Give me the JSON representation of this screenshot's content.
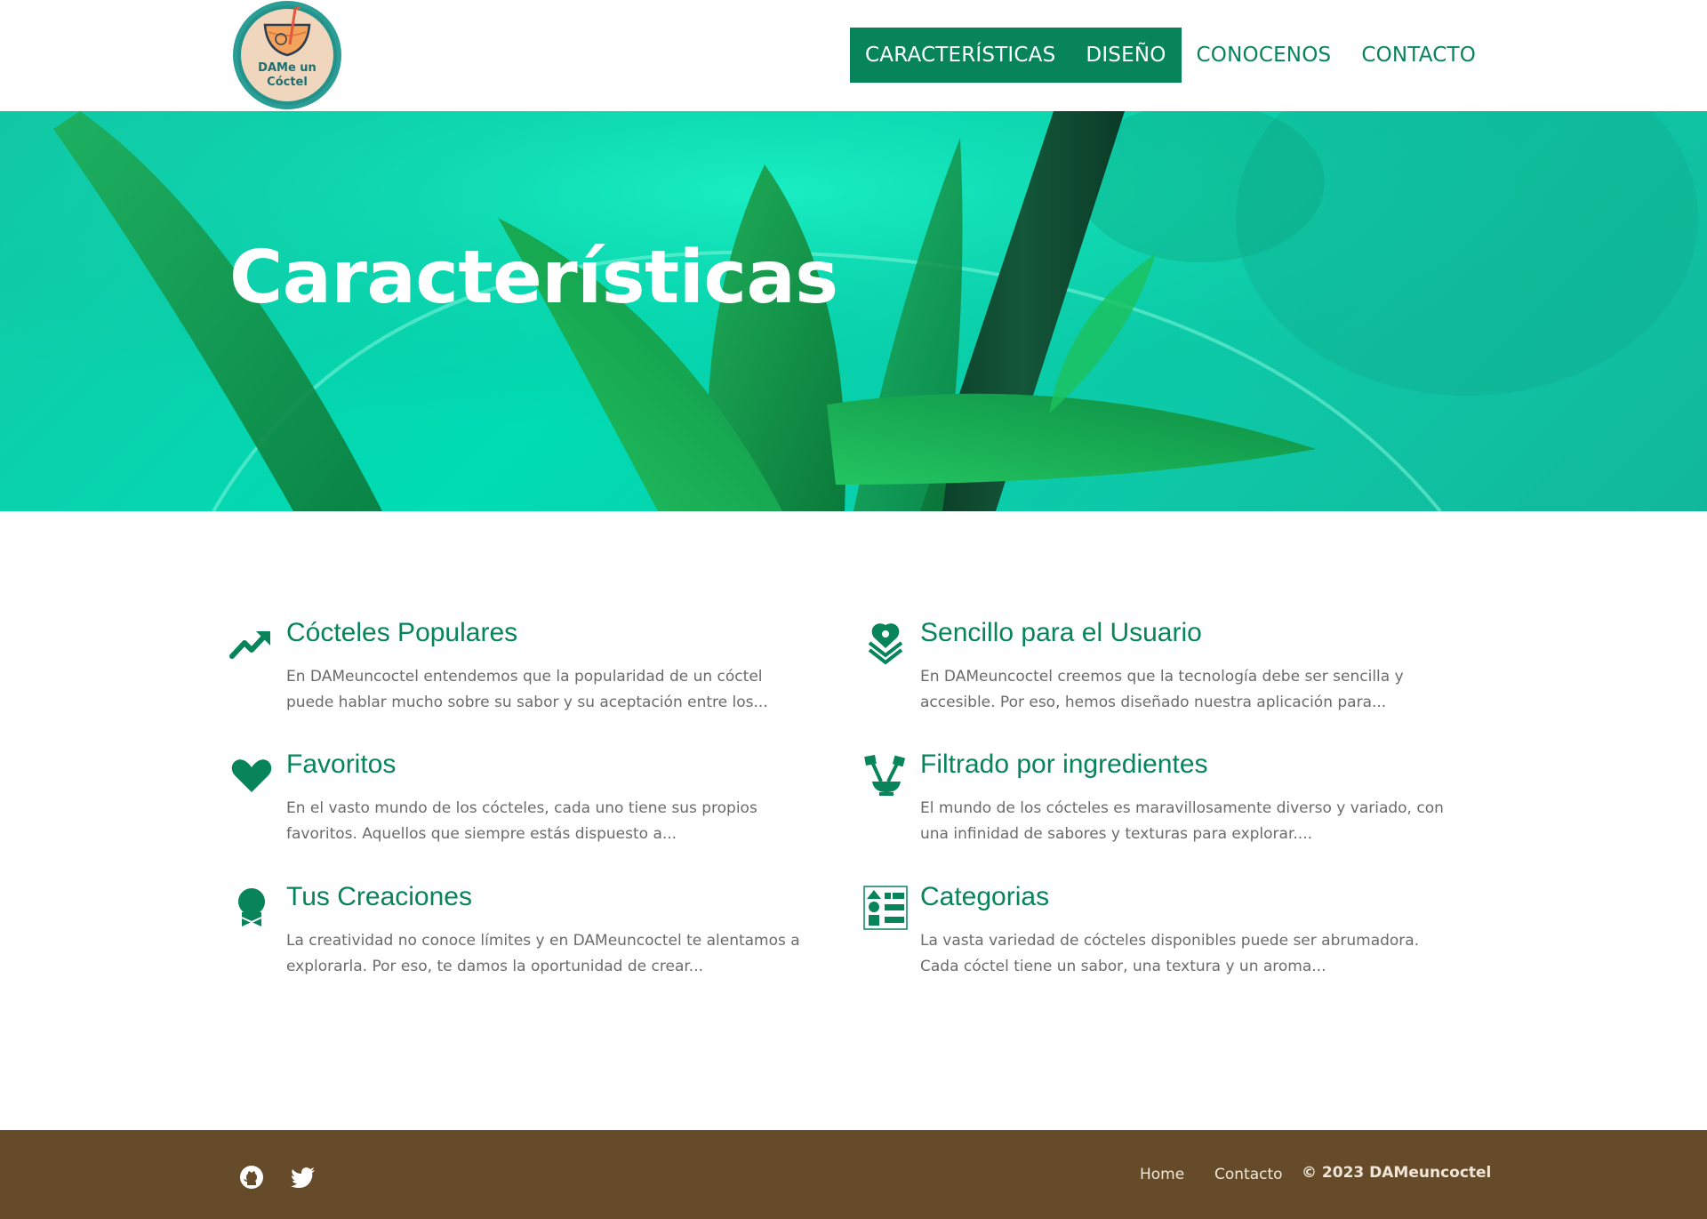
{
  "brand": {
    "logo_text_line1": "DAMe un",
    "logo_text_line2": "Cóctel",
    "logo_icon": "cocktail-glass-logo"
  },
  "nav": {
    "items": [
      {
        "label": "CARACTERÍSTICAS",
        "active": true
      },
      {
        "label": "DISEÑO",
        "active": true
      },
      {
        "label": "CONOCENOS",
        "active": false
      },
      {
        "label": "CONTACTO",
        "active": false
      }
    ]
  },
  "hero": {
    "title": "Características"
  },
  "features": [
    {
      "icon": "trending-up-icon",
      "title": "Cócteles Populares",
      "description": "En DAMeuncoctel entendemos que la popularidad de un cóctel puede hablar mucho sobre su sabor y su aceptación entre los..."
    },
    {
      "icon": "layers-heart-pin-icon",
      "title": "Sencillo para el Usuario",
      "description": "En DAMeuncoctel creemos que la tecnología debe ser sencilla y accesible. Por eso, hemos diseñado nuestra aplicación para..."
    },
    {
      "icon": "heart-icon",
      "title": "Favoritos",
      "description": "En el vasto mundo de los cócteles, cada uno tiene sus propios favoritos. Aquellos que siempre estás dispuesto a..."
    },
    {
      "icon": "mortar-pestle-icon",
      "title": "Filtrado por ingredientes",
      "description": "El mundo de los cócteles es maravillosamente diverso y variado, con una infinidad de sabores y texturas para explorar...."
    },
    {
      "icon": "award-ribbon-icon",
      "title": "Tus Creaciones",
      "description": "La creatividad no conoce límites y en DAMeuncoctel te alentamos a explorarla. Por eso, te damos la oportunidad de crear..."
    },
    {
      "icon": "category-list-icon",
      "title": "Categorias",
      "description": "La vasta variedad de cócteles disponibles puede ser abrumadora. Cada cóctel tiene un sabor, una textura y un aroma..."
    }
  ],
  "footer": {
    "social": [
      {
        "icon": "github-icon"
      },
      {
        "icon": "twitter-icon"
      }
    ],
    "links": [
      {
        "label": "Home"
      },
      {
        "label": "Contacto"
      }
    ],
    "copyright": "© 2023 DAMeuncoctel"
  },
  "colors": {
    "accent": "#07845a",
    "hero_bg": "#00dcb4",
    "footer_bg": "#664b2a",
    "footer_text": "#f0e6d8",
    "body_text": "#6b6b6b"
  }
}
